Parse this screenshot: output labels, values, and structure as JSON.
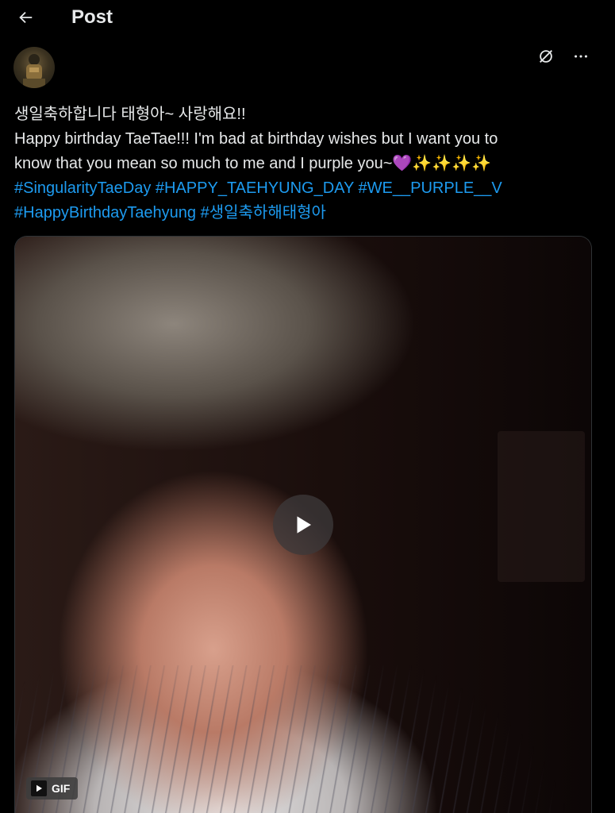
{
  "header": {
    "title": "Post",
    "back_icon": "arrow-left-icon"
  },
  "author": {
    "avatar": "avatar"
  },
  "actions": {
    "grok_icon": "grok-icon",
    "more_icon": "more-icon"
  },
  "tweet": {
    "line1": "생일축하합니다 태형아~ 사랑해요!!",
    "line2": "Happy birthday TaeTae!!! I'm bad at birthday wishes but I want you to",
    "line3_text": "know that you mean so much to me and I purple you~",
    "line3_emoji": [
      "💜",
      "✨",
      "✨",
      "✨",
      "✨"
    ],
    "hashtags_line4": [
      "#SingularityTaeDay",
      "#HAPPY_TAEHYUNG_DAY",
      "#WE__PURPLE__V"
    ],
    "hashtags_line5": [
      "#HappyBirthdayTaehyung",
      "#생일축하해태형아"
    ]
  },
  "media": {
    "type": "gif",
    "badge_label": "GIF",
    "play_icon": "play-icon"
  },
  "colors": {
    "background": "#000000",
    "text": "#e7e9ea",
    "link": "#1d9bf0",
    "border": "#2f3336"
  }
}
